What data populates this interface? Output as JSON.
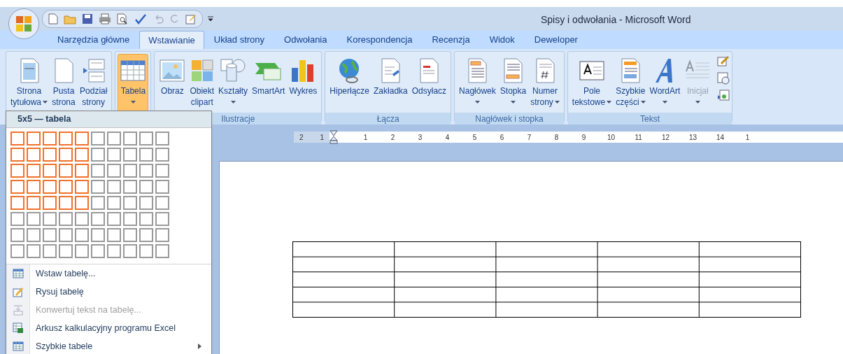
{
  "window": {
    "title": "Spisy i odwołania - Microsoft Word"
  },
  "tabs": [
    {
      "label": "Narzędzia główne",
      "selected": false
    },
    {
      "label": "Wstawianie",
      "selected": true
    },
    {
      "label": "Układ strony",
      "selected": false
    },
    {
      "label": "Odwołania",
      "selected": false
    },
    {
      "label": "Korespondencja",
      "selected": false
    },
    {
      "label": "Recenzja",
      "selected": false
    },
    {
      "label": "Widok",
      "selected": false
    },
    {
      "label": "Deweloper",
      "selected": false
    }
  ],
  "ribbon_groups": [
    {
      "buttons": [
        {
          "lines": [
            "Strona",
            "tytułowa"
          ],
          "dropdown": true,
          "selected": false,
          "disabled": false
        },
        {
          "lines": [
            "Pusta",
            "strona"
          ],
          "dropdown": false,
          "selected": false,
          "disabled": false
        },
        {
          "lines": [
            "Podział",
            "strony"
          ],
          "dropdown": false,
          "selected": false,
          "disabled": false
        }
      ]
    },
    {
      "buttons": [
        {
          "lines": [
            "Tabela"
          ],
          "dropdown": true,
          "selected": true,
          "disabled": false
        }
      ]
    },
    {
      "label": "Ilustracje",
      "buttons": [
        {
          "lines": [
            "Obraz"
          ],
          "dropdown": false,
          "selected": false,
          "disabled": false
        },
        {
          "lines": [
            "Obiekt",
            "clipart"
          ],
          "dropdown": false,
          "selected": false,
          "disabled": false
        },
        {
          "lines": [
            "Kształty"
          ],
          "dropdown": true,
          "selected": false,
          "disabled": false
        },
        {
          "lines": [
            "SmartArt"
          ],
          "dropdown": false,
          "selected": false,
          "disabled": false
        },
        {
          "lines": [
            "Wykres"
          ],
          "dropdown": false,
          "selected": false,
          "disabled": false
        }
      ]
    },
    {
      "label": "Łącza",
      "buttons": [
        {
          "lines": [
            "Hiperłącze"
          ],
          "dropdown": false,
          "selected": false,
          "disabled": false
        },
        {
          "lines": [
            "Zakładka"
          ],
          "dropdown": false,
          "selected": false,
          "disabled": false
        },
        {
          "lines": [
            "Odsyłacz"
          ],
          "dropdown": false,
          "selected": false,
          "disabled": false
        }
      ]
    },
    {
      "label": "Nagłówek i stopka",
      "buttons": [
        {
          "lines": [
            "Nagłówek"
          ],
          "dropdown": true,
          "selected": false,
          "disabled": false
        },
        {
          "lines": [
            "Stopka"
          ],
          "dropdown": true,
          "selected": false,
          "disabled": false
        },
        {
          "lines": [
            "Numer",
            "strony"
          ],
          "dropdown": true,
          "selected": false,
          "disabled": false
        }
      ]
    },
    {
      "label": "Tekst",
      "buttons": [
        {
          "lines": [
            "Pole",
            "tekstowe"
          ],
          "dropdown": true,
          "selected": false,
          "disabled": false
        },
        {
          "lines": [
            "Szybkie",
            "części"
          ],
          "dropdown": true,
          "selected": false,
          "disabled": false
        },
        {
          "lines": [
            "WordArt"
          ],
          "dropdown": true,
          "selected": false,
          "disabled": false
        },
        {
          "lines": [
            "Inicjał"
          ],
          "dropdown": true,
          "selected": false,
          "disabled": true
        }
      ]
    }
  ],
  "ruler": {
    "left_marks": [
      "2",
      "1"
    ],
    "right_marks": [
      "1",
      "2",
      "3",
      "4",
      "5",
      "6",
      "7",
      "8",
      "9",
      "10",
      "11",
      "12",
      "13",
      "14",
      "1"
    ]
  },
  "table_menu": {
    "header": "5x5 — tabela",
    "grid": [
      [
        true,
        true,
        true,
        true,
        true,
        false,
        false,
        false,
        false,
        false
      ],
      [
        true,
        true,
        true,
        true,
        true,
        false,
        false,
        false,
        false,
        false
      ],
      [
        true,
        true,
        true,
        true,
        true,
        false,
        false,
        false,
        false,
        false
      ],
      [
        true,
        true,
        true,
        true,
        true,
        false,
        false,
        false,
        false,
        false
      ],
      [
        true,
        true,
        true,
        true,
        true,
        false,
        false,
        false,
        false,
        false
      ],
      [
        false,
        false,
        false,
        false,
        false,
        false,
        false,
        false,
        false,
        false
      ],
      [
        false,
        false,
        false,
        false,
        false,
        false,
        false,
        false,
        false,
        false
      ],
      [
        false,
        false,
        false,
        false,
        false,
        false,
        false,
        false,
        false,
        false
      ]
    ],
    "items": [
      {
        "label": "Wstaw tabelę...",
        "disabled": false,
        "submenu": false
      },
      {
        "label": "Rysuj tabelę",
        "disabled": false,
        "submenu": false
      },
      {
        "label": "Konwertuj tekst na tabelę...",
        "disabled": true,
        "submenu": false
      },
      {
        "label": "Arkusz kalkulacyjny programu Excel",
        "disabled": false,
        "submenu": false
      },
      {
        "label": "Szybkie tabele",
        "disabled": false,
        "submenu": true
      }
    ]
  }
}
